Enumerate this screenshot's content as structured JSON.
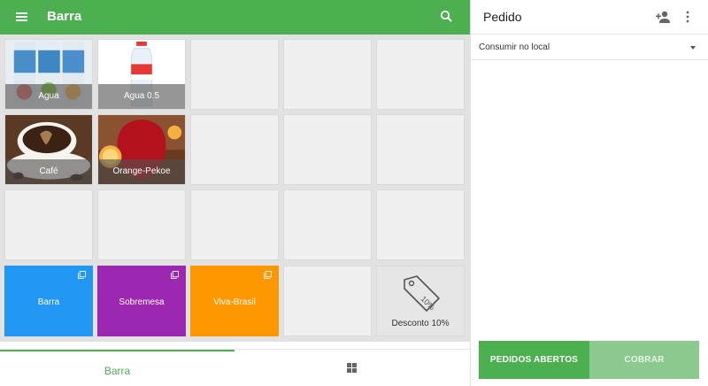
{
  "app": {
    "title": "Barra",
    "icons": {
      "menu": "hamburger-menu-icon",
      "search": "search-icon"
    }
  },
  "products": [
    {
      "name": "Agua",
      "image": "water-bottles-photo"
    },
    {
      "name": "Agua 0.5",
      "image": "water-bottle-photo"
    },
    {
      "name": "Café",
      "image": "coffee-cup-photo"
    },
    {
      "name": "Orange-Pekoe",
      "image": "tea-glass-photo"
    }
  ],
  "categories": [
    {
      "name": "Barra",
      "color": "#2196f3"
    },
    {
      "name": "Sobremesa",
      "color": "#9c27b0"
    },
    {
      "name": "Viva-Brasil",
      "color": "#ff9800"
    }
  ],
  "discount": {
    "name": "Desconto 10%",
    "tag_text": "10%"
  },
  "bottom_nav": {
    "active_tab": "Barra",
    "grid_icon": "grid-view-icon"
  },
  "order": {
    "title": "Pedido",
    "mode": "Consumir no local",
    "buttons": {
      "open_orders": "PEDIDOS ABERTOS",
      "charge": "COBRAR"
    }
  },
  "colors": {
    "accent": "#4caf50",
    "charge_disabled": "#8bc98f"
  }
}
